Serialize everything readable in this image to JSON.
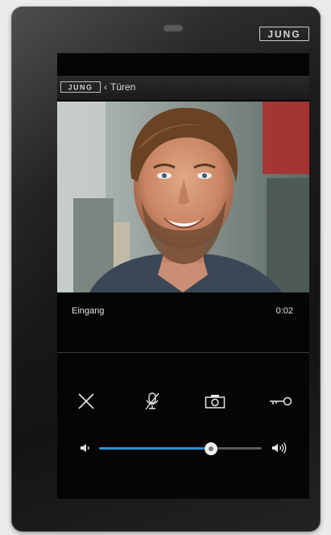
{
  "device": {
    "brand": "JUNG"
  },
  "screen": {
    "header": {
      "logo": "JUNG",
      "back_icon": "chevron-left-icon",
      "breadcrumb": "Türen"
    },
    "call": {
      "door_name": "Eingang",
      "elapsed": "0:02"
    },
    "controls": [
      {
        "name": "hang-up",
        "icon": "close-icon"
      },
      {
        "name": "mute-microphone",
        "icon": "mic-off-icon"
      },
      {
        "name": "snapshot",
        "icon": "camera-icon"
      },
      {
        "name": "open-door",
        "icon": "key-icon"
      }
    ],
    "volume": {
      "level": 0.69,
      "min_icon": "volume-low-icon",
      "max_icon": "volume-high-icon"
    },
    "colors": {
      "accent": "#2e8fd0",
      "background": "#050505",
      "text": "#e4e4e4"
    }
  }
}
